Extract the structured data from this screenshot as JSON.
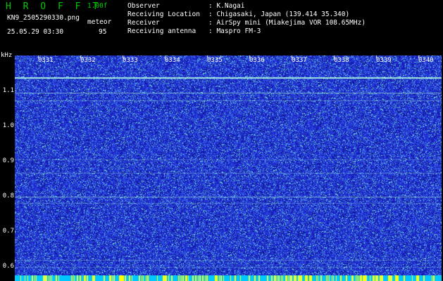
{
  "header": {
    "app_title": "H R O F F T",
    "version": "1.00f",
    "filename": "KN9_2505290330.png",
    "mode": "meteor",
    "datetime": "25.05.29 03:30",
    "count": "95",
    "observer_key": "Observer",
    "observer_value": ": K.Nagai",
    "location_key": "Receiving Location",
    "location_value": ": Chigasaki, Japan (139.414 35.340)",
    "receiver_key": "Receiver",
    "receiver_value": ": AirSpy mini (Miakejima VOR 108.65MHz)",
    "antenna_key": "Receiving antenna",
    "antenna_value": ": Maspro FM-3"
  },
  "spectrogram": {
    "y_unit": "kHz",
    "y_ticks": [
      "1.1",
      "1.0",
      "0.9",
      "0.8",
      "0.7",
      "0.6"
    ],
    "x_ticks": [
      "0331",
      "0332",
      "0333",
      "0334",
      "0335",
      "0336",
      "0337",
      "0338",
      "0339",
      "0340"
    ],
    "colors": {
      "background": "#1a1fc8",
      "noise": "#3a6af0",
      "signal": "#7ff0d0",
      "line": "#b0ffe0"
    }
  }
}
